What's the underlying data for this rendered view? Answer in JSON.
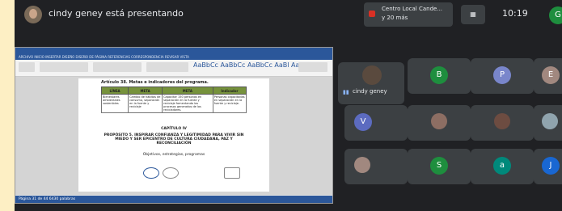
{
  "presenter_text": "cindy geney está presentando",
  "meet_chip": {
    "line1": "Centro Local Cande...",
    "line2": "y 20 más"
  },
  "controls": [
    "ctrl-1",
    "ctrl-2"
  ],
  "time": "10:19",
  "badge_letter": "G",
  "document": {
    "heading": "Artículo 38. Metas e indicadores del programa.",
    "table_headers": [
      "LÍNEA",
      "META",
      "META",
      "Indicador"
    ],
    "table_row": [
      "Bienestares ambientales sostenibles",
      "Cambio de hábitos de consumo, separación en la fuente y reciclaje",
      "Capacitar 150 personas en separación en la fuente y reciclaje fomentando los procesos generados de los recicladores.",
      "Personas capacitadas en separación en la fuente y reciclaje."
    ],
    "chapter_title": "CAPÍTULO IV",
    "chapter_subtitle": "PROPÓSITO 5. INSPIRAR CONFIANZA Y LEGITIMIDAD PARA VIVIR SIN MIEDO Y SER EPICENTRO DE CULTURA CIUDADANA, PAZ Y RECONCILIACIÓN",
    "objectives": "Objetivos, estrategias, programas",
    "status": "Página 31 de 44    6430 palabras"
  },
  "participants": {
    "speaker_name": "cindy geney",
    "letters": [
      "B",
      "P",
      "E",
      "V",
      "S",
      "a",
      "J"
    ],
    "colors": {
      "B": "#1e8e3e",
      "P": "#7986cb",
      "E": "#a1887f",
      "V": "#5c6bc0",
      "S": "#1e8e3e",
      "a": "#00897b",
      "J": "#1967d2"
    }
  }
}
